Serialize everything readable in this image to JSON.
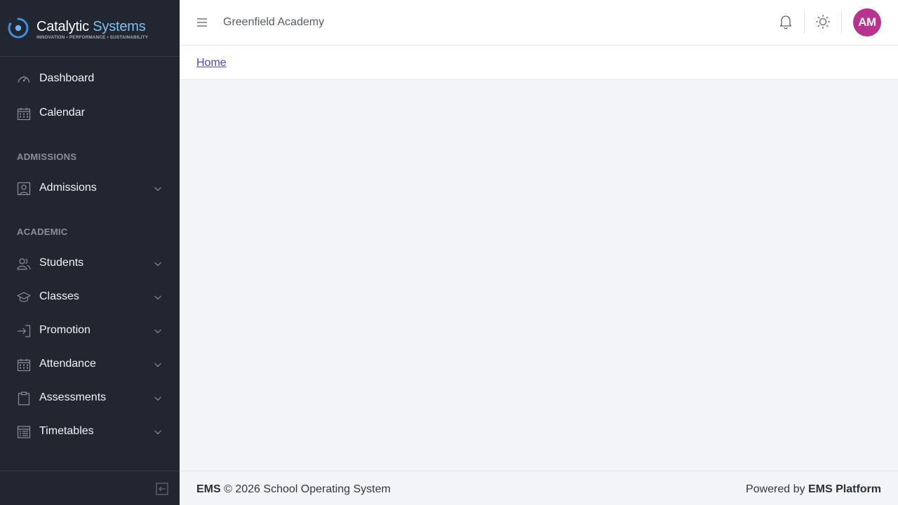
{
  "brand": {
    "name_part1": "Catalytic",
    "name_part2": "Systems",
    "tagline": "INNOVATION • PERFORMANCE • SUSTAINABILITY"
  },
  "sidebar": {
    "items_top": [
      {
        "label": "Dashboard",
        "icon": "speedometer-icon"
      },
      {
        "label": "Calendar",
        "icon": "calendar-icon"
      }
    ],
    "sections": [
      {
        "title": "ADMISSIONS",
        "items": [
          {
            "label": "Admissions",
            "icon": "person-badge-icon",
            "expandable": true
          }
        ]
      },
      {
        "title": "ACADEMIC",
        "items": [
          {
            "label": "Students",
            "icon": "people-icon",
            "expandable": true
          },
          {
            "label": "Classes",
            "icon": "graduation-cap-icon",
            "expandable": true
          },
          {
            "label": "Promotion",
            "icon": "arrow-right-box-icon",
            "expandable": true
          },
          {
            "label": "Attendance",
            "icon": "calendar-icon",
            "expandable": true
          },
          {
            "label": "Assessments",
            "icon": "clipboard-icon",
            "expandable": true
          },
          {
            "label": "Timetables",
            "icon": "table-list-icon",
            "expandable": true
          }
        ]
      }
    ]
  },
  "header": {
    "school_name": "Greenfield Academy",
    "avatar_initials": "AM",
    "avatar_color": "#b8338e"
  },
  "breadcrumb": {
    "home_label": "Home"
  },
  "footer": {
    "brand": "EMS",
    "copyright": "© 2026 School Operating System",
    "powered_prefix": "Powered by",
    "powered_name": "EMS Platform"
  },
  "colors": {
    "sidebar_bg": "#212631",
    "accent_link": "#4f46c8",
    "brand_blue": "#7cc0ef"
  }
}
